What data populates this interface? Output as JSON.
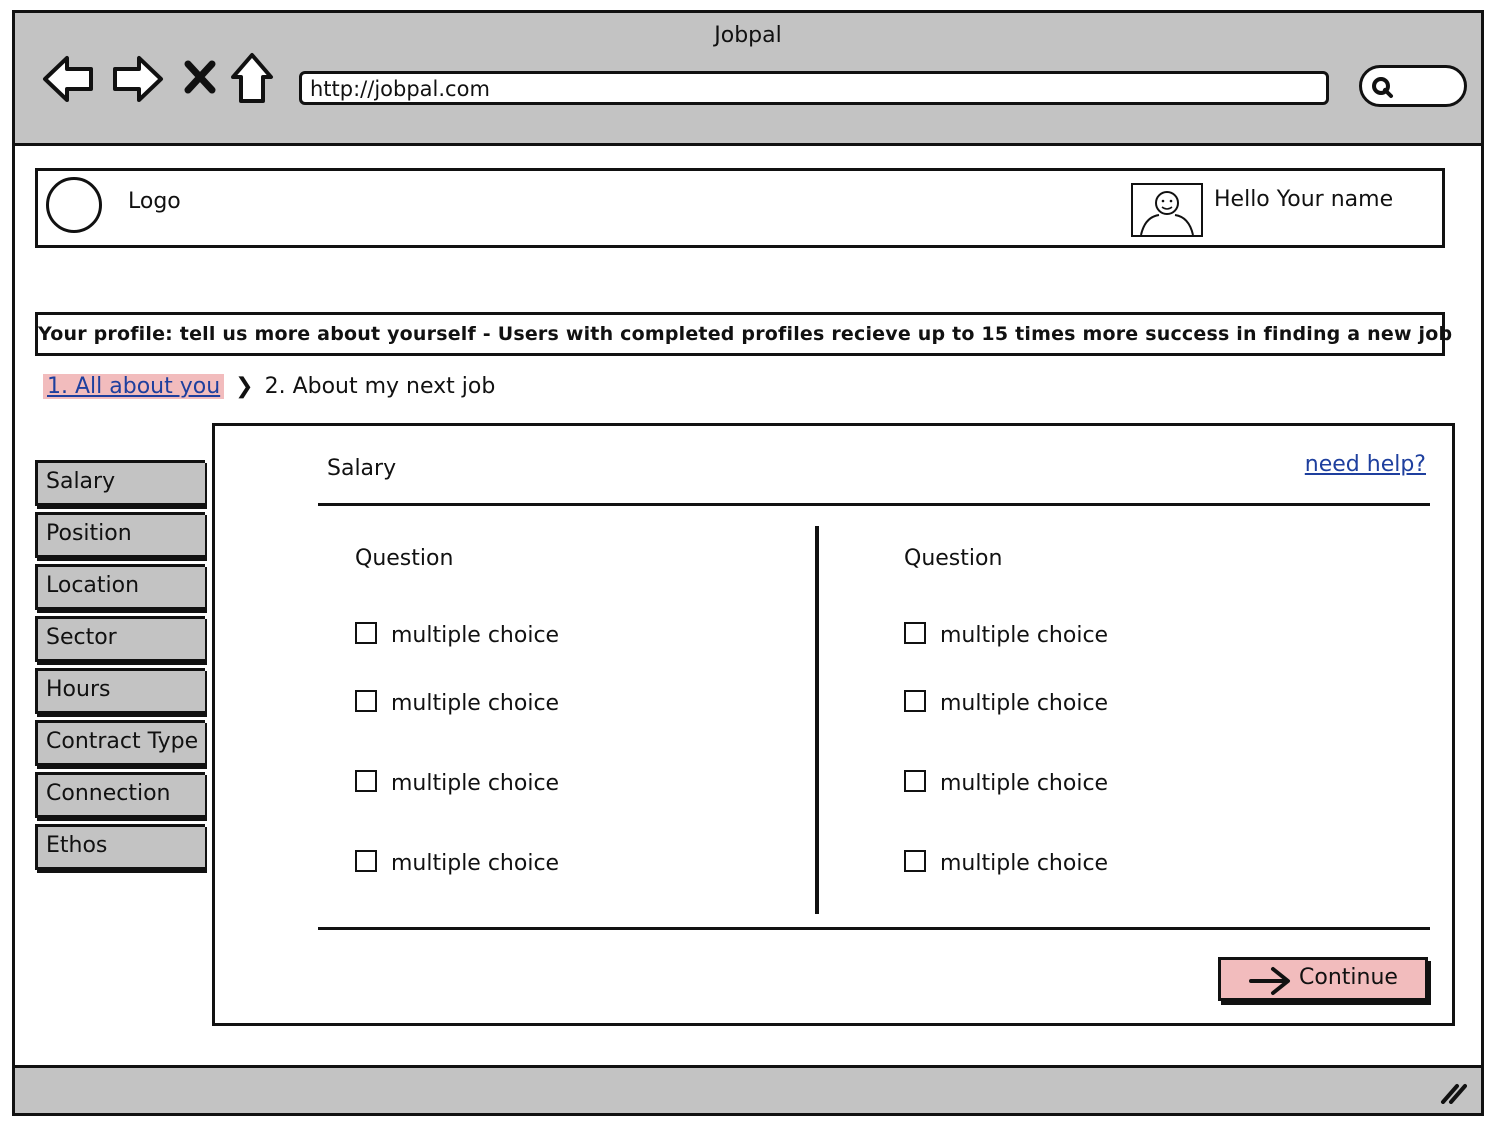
{
  "window": {
    "title": "Jobpal"
  },
  "browser": {
    "url": "http://jobpal.com"
  },
  "header": {
    "logo_label": "Logo",
    "greeting": "Hello Your name"
  },
  "banner": {
    "text": "Your profile: tell us more about yourself - Users with completed profiles recieve up to 15 times more success in finding a new job"
  },
  "breadcrumb": {
    "step1": "1. All about you",
    "separator": "❯",
    "step2": "2. About my next job"
  },
  "sidebar": {
    "tabs": [
      "Salary",
      "Position",
      "Location",
      "Sector",
      "Hours",
      "Contract Type",
      "Connection",
      "Ethos"
    ]
  },
  "panel": {
    "title": "Salary",
    "help": "need help?",
    "left": {
      "question": "Question",
      "options": [
        "multiple choice",
        "multiple choice",
        "multiple choice",
        "multiple choice"
      ]
    },
    "right": {
      "question": "Question",
      "options": [
        "multiple choice",
        "multiple choice",
        "multiple choice",
        "multiple choice"
      ]
    },
    "continue_label": "Continue"
  },
  "colors": {
    "accent_pink": "#f2bcbd",
    "link_blue": "#1e3f9e",
    "chrome_gray": "#c3c3c3"
  }
}
